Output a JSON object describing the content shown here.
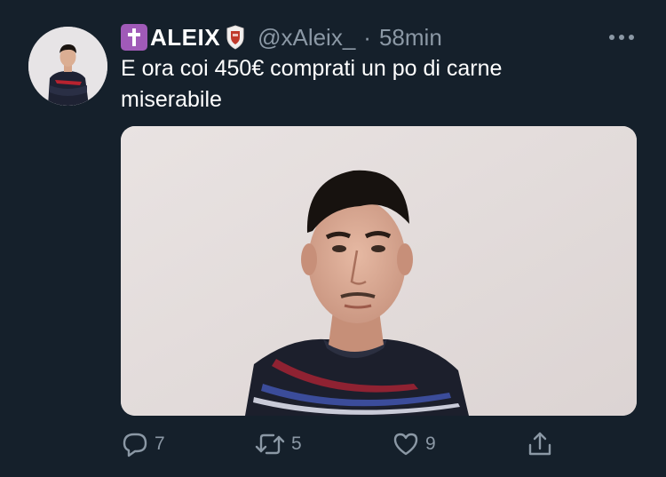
{
  "tweet": {
    "author": {
      "badge_icon": "latin-cross-icon",
      "display_name": "ALEIX",
      "shield_icon": "shield-icon",
      "handle": "@xAleix_",
      "separator": "·",
      "time": "58min"
    },
    "text_line1": "E ora coi 450€ comprati un po di carne",
    "text_line2": "miserabile",
    "media": {
      "description_icon": "photo"
    },
    "actions": {
      "reply_count": "7",
      "retweet_count": "5",
      "like_count": "9"
    }
  },
  "colors": {
    "background": "#15202b",
    "text": "#ffffff",
    "secondary": "#8b98a5",
    "badge": "#a05ab8"
  }
}
